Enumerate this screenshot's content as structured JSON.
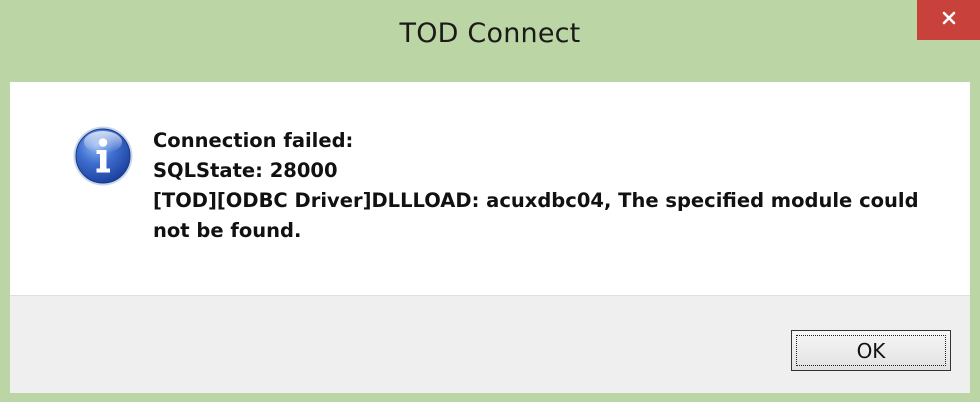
{
  "window": {
    "title": "TOD Connect",
    "close_symbol": "✕",
    "accent_color": "#bcd5a4",
    "close_color": "#c8413a"
  },
  "message": {
    "icon": "info-icon",
    "lines": [
      "Connection failed:",
      "SQLState: 28000",
      "[TOD][ODBC Driver]DLLLOAD: acuxdbc04, The specified module could",
      "not be found."
    ]
  },
  "buttons": {
    "ok_label": "OK"
  }
}
